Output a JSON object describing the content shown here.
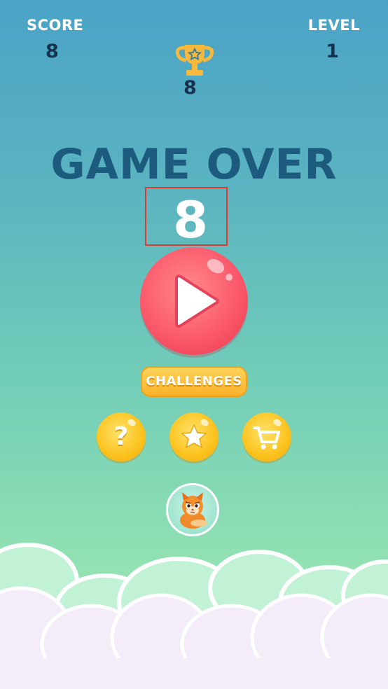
{
  "hud": {
    "score_label": "SCORE",
    "score_value": "8",
    "level_label": "LEVEL",
    "level_value": "1",
    "best_value": "8"
  },
  "gameover": {
    "title": "GAME OVER",
    "final_score": "8"
  },
  "buttons": {
    "challenges_label": "CHALLENGES",
    "help_glyph": "?"
  },
  "colors": {
    "title": "#1c5a7e",
    "play": "#fb5a6c",
    "gold": "#fcc21d",
    "highlight_box": "#e23a2e"
  },
  "icons": [
    "trophy-icon",
    "play-icon",
    "help-icon",
    "star-icon",
    "cart-icon",
    "cat-character"
  ]
}
